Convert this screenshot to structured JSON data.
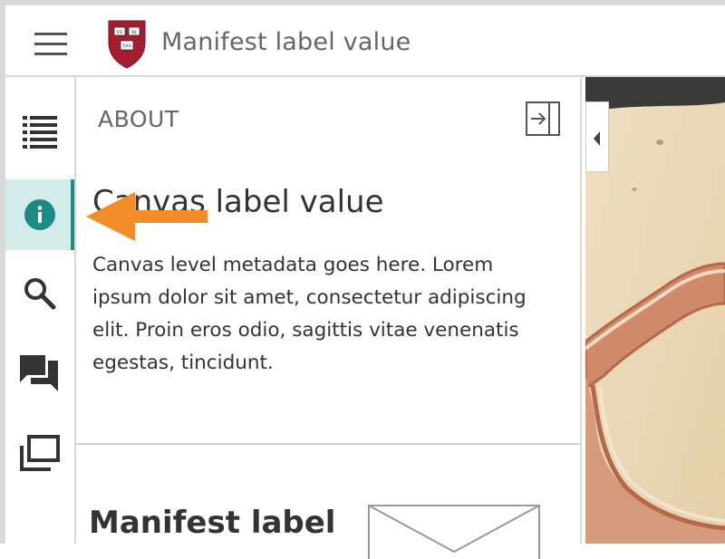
{
  "header": {
    "title": "Manifest label value",
    "logo_text": [
      "VE",
      "RI",
      "TAS"
    ],
    "menu_icon": "hamburger-menu-icon"
  },
  "rail": {
    "items": [
      {
        "name": "index",
        "icon": "list-icon"
      },
      {
        "name": "info",
        "icon": "info-icon",
        "active": true
      },
      {
        "name": "search",
        "icon": "search-icon"
      },
      {
        "name": "annotations",
        "icon": "annotations-icon"
      },
      {
        "name": "layers",
        "icon": "layers-icon"
      }
    ]
  },
  "sidebar": {
    "heading": "ABOUT",
    "canvas_label": "Canvas label value",
    "canvas_description": "Canvas level metadata goes here. Lorem ipsum dolor sit amet, consectetur adipiscing elit. Proin eros odio, sagittis vitae venenatis egestas, tincidunt.",
    "manifest_label": "Manifest label"
  },
  "colors": {
    "accent": "#1e8a86",
    "active_bg": "#d3ecea",
    "callout": "#f28c28",
    "logo_red": "#a51c30"
  }
}
